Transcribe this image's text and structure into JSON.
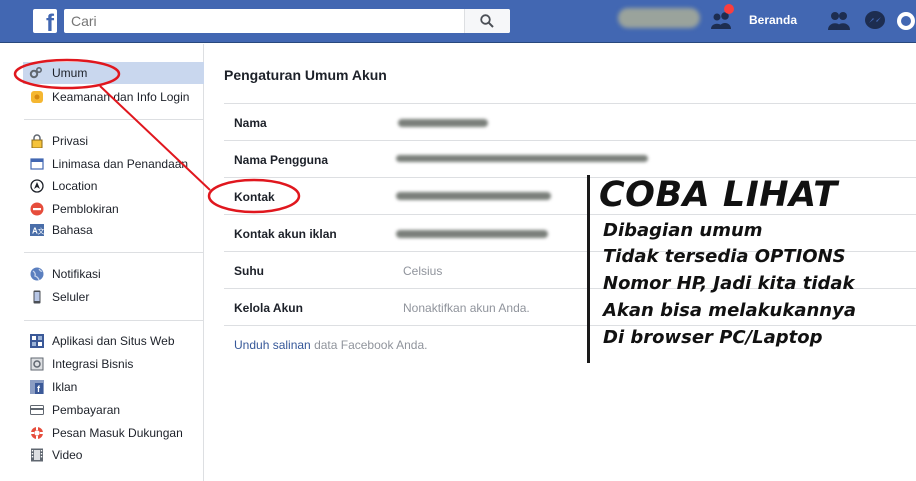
{
  "topbar": {
    "search_placeholder": "Cari",
    "home_label": "Beranda",
    "brand_color": "#4267b2"
  },
  "sidebar": {
    "group1": [
      {
        "label": "Umum",
        "icon": "gears-icon",
        "selected": true
      },
      {
        "label": "Keamanan dan Info Login",
        "icon": "shield-badge-icon"
      }
    ],
    "group2": [
      {
        "label": "Privasi",
        "icon": "lock-icon"
      },
      {
        "label": "Linimasa dan Penandaan",
        "icon": "timeline-icon"
      },
      {
        "label": "Location",
        "icon": "location-icon"
      },
      {
        "label": "Pemblokiran",
        "icon": "block-icon"
      },
      {
        "label": "Bahasa",
        "icon": "language-icon"
      }
    ],
    "group3": [
      {
        "label": "Notifikasi",
        "icon": "globe-icon"
      },
      {
        "label": "Seluler",
        "icon": "mobile-icon"
      }
    ],
    "group4": [
      {
        "label": "Aplikasi dan Situs Web",
        "icon": "apps-icon"
      },
      {
        "label": "Integrasi Bisnis",
        "icon": "business-icon"
      },
      {
        "label": "Iklan",
        "icon": "ads-icon"
      },
      {
        "label": "Pembayaran",
        "icon": "card-icon"
      },
      {
        "label": "Pesan Masuk Dukungan",
        "icon": "lifebuoy-icon"
      },
      {
        "label": "Video",
        "icon": "film-icon"
      }
    ]
  },
  "main": {
    "title": "Pengaturan Umum Akun",
    "rows": [
      {
        "label": "Nama",
        "value": ""
      },
      {
        "label": "Nama Pengguna",
        "value": ""
      },
      {
        "label": "Kontak",
        "value": ""
      },
      {
        "label": "Kontak akun iklan",
        "value": ""
      },
      {
        "label": "Suhu",
        "value": "Celsius"
      },
      {
        "label": "Kelola Akun",
        "value": "Nonaktifkan akun Anda."
      }
    ],
    "footer_link": "Unduh salinan",
    "footer_text": " data Facebook Anda."
  },
  "annotation": {
    "title": "COBA LIHAT",
    "lines": [
      "Dibagian umum",
      "Tidak tersedia OPTIONS",
      "Nomor HP, Jadi kita tidak",
      "Akan bisa melakukannya",
      "Di browser PC/Laptop"
    ],
    "circle_color": "#e0171e"
  }
}
